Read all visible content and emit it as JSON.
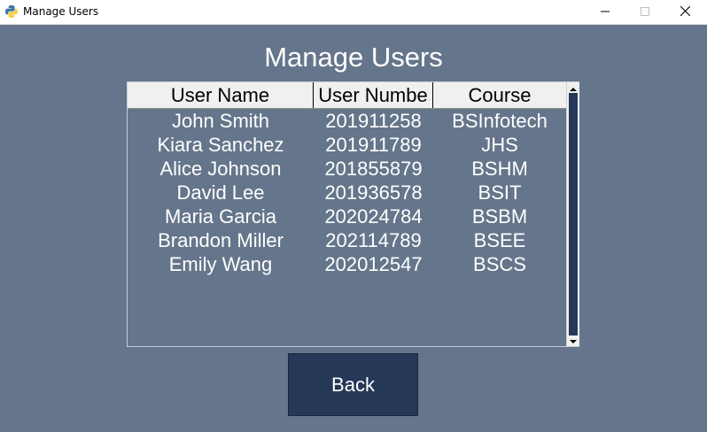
{
  "window": {
    "title": "Manage Users"
  },
  "page": {
    "title": "Manage Users"
  },
  "table": {
    "columns": [
      "User Name",
      "User Numbe",
      "Course"
    ],
    "rows": [
      [
        "John Smith",
        "201911258",
        "BSInfotech"
      ],
      [
        "Kiara Sanchez",
        "201911789",
        "JHS"
      ],
      [
        "Alice Johnson",
        "201855879",
        "BSHM"
      ],
      [
        "David Lee",
        "201936578",
        "BSIT"
      ],
      [
        "Maria Garcia",
        "202024784",
        "BSBM"
      ],
      [
        "Brandon Miller",
        "202114789",
        "BSEE"
      ],
      [
        "Emily Wang",
        "202012547",
        "BSCS"
      ]
    ]
  },
  "actions": {
    "back_label": "Back"
  },
  "icons": {
    "app": "python-icon",
    "minimize": "minimize-icon",
    "maximize": "maximize-icon",
    "close": "close-icon",
    "scroll_up": "arrow-up-icon",
    "scroll_down": "arrow-down-icon"
  },
  "colors": {
    "background": "#65758b",
    "button": "#263858",
    "header": "#f0f0f0",
    "text": "#ffffff"
  }
}
